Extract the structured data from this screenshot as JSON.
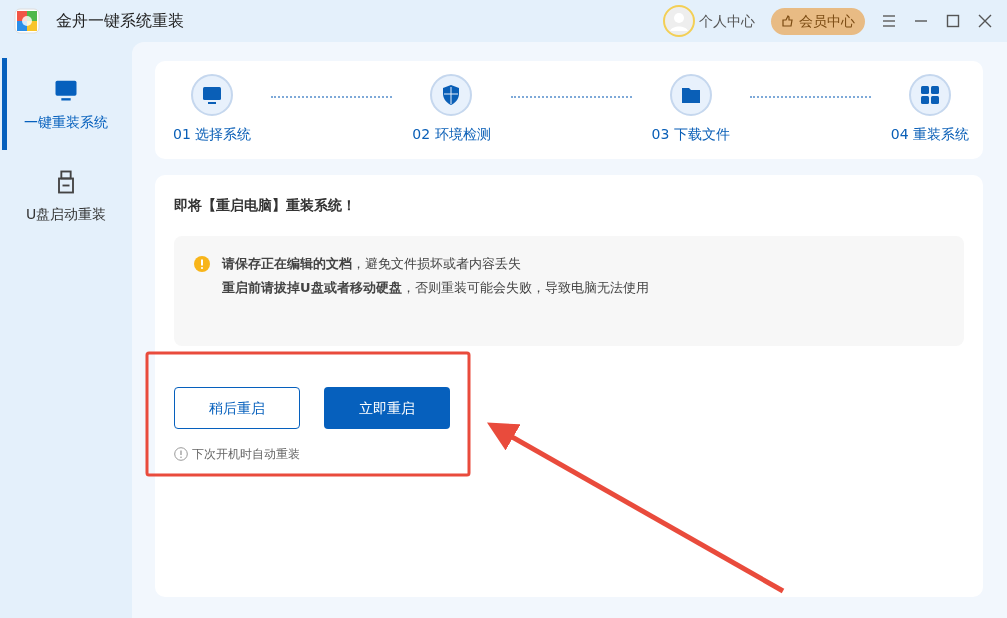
{
  "window": {
    "title": "金舟一键系统重装"
  },
  "header": {
    "profile": "个人中心",
    "vip": "会员中心"
  },
  "sidebar": {
    "items": [
      {
        "kind": "monitor",
        "label": "一键重装系统",
        "selected": true
      },
      {
        "kind": "usb",
        "label": "U盘启动重装",
        "selected": false
      }
    ]
  },
  "steps": [
    {
      "kind": "monitor",
      "label": "01 选择系统"
    },
    {
      "kind": "shield",
      "label": "02 环境检测"
    },
    {
      "kind": "folder",
      "label": "03 下载文件"
    },
    {
      "kind": "grid",
      "label": "04 重装系统"
    }
  ],
  "main": {
    "heading": "即将【重启电脑】重装系统！",
    "notices": [
      "**请保存正在编辑的文档**，避免文件损坏或者内容丢失",
      "**重启前请拔掉U盘或者移动硬盘**，否则重装可能会失败，导致电脑无法使用"
    ],
    "buttons": [
      {
        "label": "稍后重启",
        "kind": "outline"
      },
      {
        "label": "立即重启",
        "kind": "primary"
      }
    ],
    "hint": "下次开机时自动重装"
  }
}
